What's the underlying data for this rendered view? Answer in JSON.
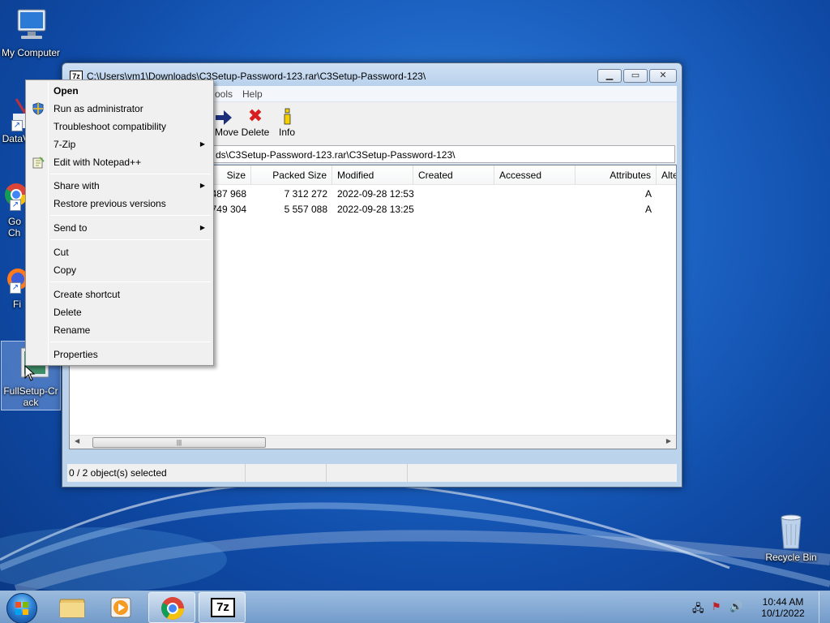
{
  "desktop": {
    "icons": {
      "my_computer": "My Computer",
      "data": "DataV",
      "chrome": "Go\nCh",
      "firefox": "Fi",
      "fullsetup": "FullSetup-Crack",
      "recycle_bin": "Recycle Bin"
    }
  },
  "window": {
    "title": "C:\\Users\\vm1\\Downloads\\C3Setup-Password-123.rar\\C3Setup-Password-123\\",
    "app_icon": "7z",
    "menu": {
      "tools": "ools",
      "help": "Help"
    },
    "toolbar": {
      "move": "Move",
      "delete": "Delete",
      "info": "Info"
    },
    "address": "ds\\C3Setup-Password-123.rar\\C3Setup-Password-123\\",
    "columns": {
      "size": "Size",
      "packed_size": "Packed Size",
      "modified": "Modified",
      "created": "Created",
      "accessed": "Accessed",
      "attributes": "Attributes",
      "alte": "Alte"
    },
    "rows": [
      {
        "size": "487 968",
        "packed_size": "7 312 272",
        "modified": "2022-09-28 12:53",
        "attributes": "A"
      },
      {
        "size": "749 304",
        "packed_size": "5 557 088",
        "modified": "2022-09-28 13:25",
        "attributes": "A"
      }
    ],
    "status": "0 / 2 object(s) selected"
  },
  "context_menu": {
    "open": "Open",
    "run_as_admin": "Run as administrator",
    "troubleshoot": "Troubleshoot compatibility",
    "seven_zip": "7-Zip",
    "edit_notepad": "Edit with Notepad++",
    "share_with": "Share with",
    "restore": "Restore previous versions",
    "send_to": "Send to",
    "cut": "Cut",
    "copy": "Copy",
    "create_shortcut": "Create shortcut",
    "delete": "Delete",
    "rename": "Rename",
    "properties": "Properties"
  },
  "taskbar": {
    "time": "10:44 AM",
    "date": "10/1/2022",
    "sevenzip_label": "7z"
  },
  "colors": {
    "accent": "#1d64c4",
    "delete_red": "#d81e1e",
    "info_yellow": "#f5d000"
  }
}
